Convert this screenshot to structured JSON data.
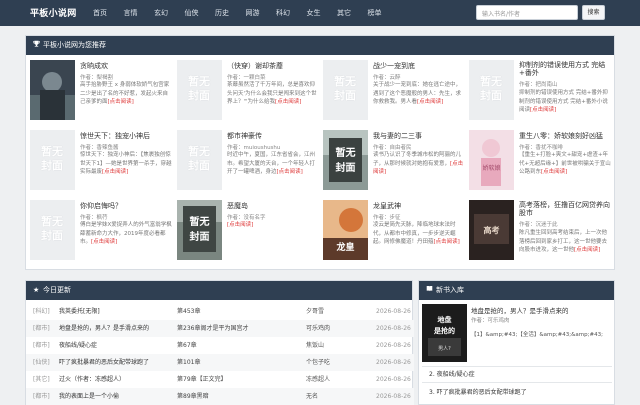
{
  "site": {
    "logo": "平板小说网"
  },
  "nav": [
    "首页",
    "言情",
    "玄幻",
    "仙侠",
    "历史",
    "网游",
    "科幻",
    "女生",
    "其它",
    "榜单"
  ],
  "search": {
    "placeholder": "输入书名/作者",
    "button": "搜索"
  },
  "recommend": {
    "title": "平板小说网为您推荐",
    "read_label": "[点击阅读]",
    "placeholder_cover_text": "暂无封面",
    "books": [
      {
        "title": "贪晌成欢",
        "author": "作者：梨褐割",
        "desc": "高手抬胁野王 x 身弱体软娇气包宫家二少是出了名的不好惹，发起火来自己亲爹的面",
        "cover": "photo-dark"
      },
      {
        "title": "（快穿）谢却茶蘼",
        "author": "作者：一颗白菜",
        "desc": "茶蘼虽然活了千万年间，总是喜欢仰头问天'为什么会我只是闯来到这个世界上？'\"为什么给我",
        "cover": "placeholder"
      },
      {
        "title": "战少一宠到底",
        "author": "作者：云醉",
        "desc": "关于战少一宠到底：她在逃亡途中，遇到了这个恶魔般的男人：先生，求你救救我。男人看",
        "cover": "placeholder"
      },
      {
        "title": "抑制剂的错误使用方式 完结+番外",
        "author": "作者：把尚南山",
        "desc": "抑制剂的错误使用方式 完结+番外抑制剂的错误使用方式 完结+番外小说阅读",
        "cover": "placeholder"
      },
      {
        "title": "惊世天下：独宠小神后",
        "author": "作者：香辣鱼酱",
        "desc": "惊世天下：独宠小神后：【焦裹独创惊世天下1】—她是世界第一杀手，穿越实际最废",
        "cover": "placeholder"
      },
      {
        "title": "都市神豪传",
        "author": "作者：muioushushu",
        "desc": "时近中午，夏国，江东省省会，江州市。希望大厦的天台，一个年轻人打开了一罐啤酒，身边",
        "cover": "placeholder-dark"
      },
      {
        "title": "我与妻的二三事",
        "author": "作者：自由者民",
        "desc": "读书乃认识了冬季城市松的阿骊的儿子，从那时候就对她抱有爱意，",
        "cover": "photo-clock"
      },
      {
        "title": "重生八零：娇软娘刻好凶猛",
        "author": "作者：香扰不咖啡",
        "desc": "【重生+打脸+爽文+甜宠+虐渣+年代+无超后缘+】前世被哄骗关于宣山公路到东",
        "cover": "photo-pink"
      },
      {
        "title": "你仰启悔吗？",
        "author": "作者：枫荇",
        "desc": "傅白是学妹X爱捉弄人的外气富翁学枫薛蓄新命力大作，2019年度必看都市。",
        "cover": "placeholder"
      },
      {
        "title": "恶魔岛",
        "author": "作者：没有名字",
        "desc": "",
        "cover": "placeholder-dark"
      },
      {
        "title": "龙皇武神",
        "author": "作者：步征",
        "desc": "凌云是简先天脉，降临地球末法时代，从都市中修真，一步步逆天崛起。网修佛魔道！丹田蕴",
        "cover": "photo-dragon"
      },
      {
        "title": "高考落榜，狂撸百亿网贷养向股市",
        "author": "作者：沉迷于此",
        "desc": "陈凡重生回到高考结束后，上一次他落榜后回到家乡打工，这一世他要去向股市进攻，这一世他",
        "cover": "photo-book"
      }
    ]
  },
  "updates": {
    "title": "今日更新",
    "rows": [
      {
        "type": "[科幻]",
        "title": "我英委托[无限]",
        "chapter": "第453章",
        "author": "夕哥雪",
        "date": "2026-08-26"
      },
      {
        "type": "[都市]",
        "title": "地盘是抢的，男人？是手滑点来的",
        "chapter": "第236章阁才是平为国宫才",
        "author": "可乐鸡肉",
        "date": "2026-08-26"
      },
      {
        "type": "[都市]",
        "title": "夜船线/疑心症",
        "chapter": "第67章",
        "author": "焦饭山",
        "date": "2026-08-26"
      },
      {
        "type": "[仙侠]",
        "title": "吓了疯批暴君的恶后女配带球跑了",
        "chapter": "第101章",
        "author": "个包子吃",
        "date": "2026-08-26"
      },
      {
        "type": "[其它]",
        "title": "过火（作者：冻感超人）",
        "chapter": "第79章【正文完】",
        "author": "冻感超人",
        "date": "2026-08-26"
      },
      {
        "type": "[都市]",
        "title": "我的表面上是一个小偷",
        "chapter": "第89章黑暗",
        "author": "无名",
        "date": "2026-08-26"
      }
    ]
  },
  "newbooks": {
    "title": "新书入库",
    "featured": {
      "title": "地盘是抢的，男人？是手滑点来的",
      "author": "作者：可乐鸡肉",
      "desc": "【1】&amp;#43;【全活】&amp;#43;&amp;#43;"
    },
    "items": [
      "2. 夜船线/疑心症",
      "3. 吓了疯批暴君的恶后女配带球跑了"
    ]
  }
}
